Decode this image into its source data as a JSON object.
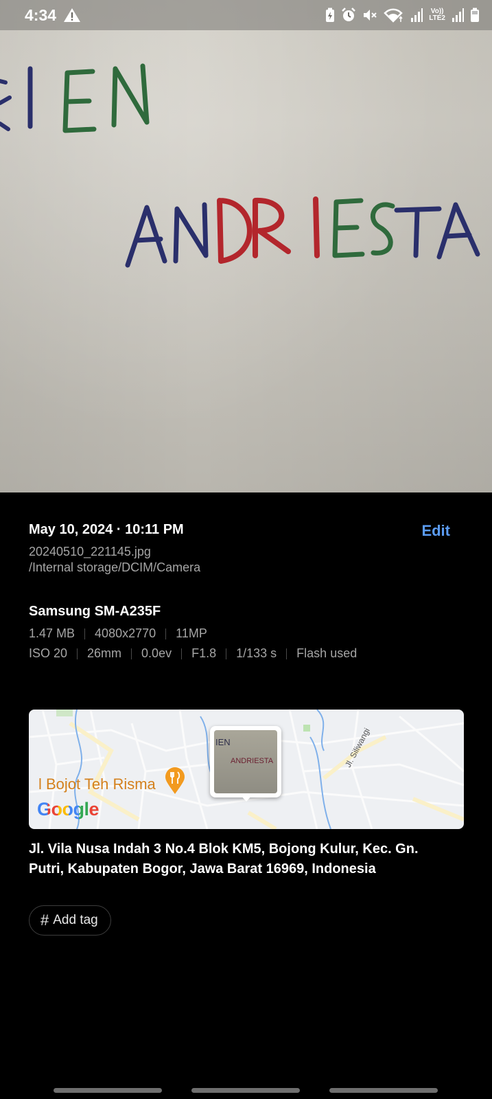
{
  "status_bar": {
    "time": "4:34",
    "icons": [
      "warning-icon",
      "battery-saver-icon",
      "alarm-icon",
      "mute-icon",
      "wifi-icon",
      "signal-icon",
      "volte-icon",
      "signal-icon-2",
      "battery-icon"
    ],
    "volte_label_top": "Vo))",
    "volte_label_bottom": "LTE2"
  },
  "photo": {
    "handwriting_line1": "RIEN",
    "handwriting_line2": "ANDRIESTA"
  },
  "details": {
    "datetime": "May 10, 2024 · 10:11 PM",
    "edit_label": "Edit",
    "filename": "20240510_221145.jpg",
    "path": "/Internal storage/DCIM/Camera",
    "device": "Samsung SM-A235F",
    "specs_row1": [
      "1.47 MB",
      "4080x2770",
      "11MP"
    ],
    "specs_row2": [
      "ISO 20",
      "26mm",
      "0.0ev",
      "F1.8",
      "1/133 s",
      "Flash used"
    ]
  },
  "map": {
    "place_label": "l Bojot Teh Risma",
    "street_label": "Jl. Siliwangi",
    "logo": "Google",
    "thumbnail_line1": "IEN",
    "thumbnail_line2": "ANDRIESTA"
  },
  "address": "Jl. Vila Nusa Indah 3 No.4 Blok KM5, Bojong Kulur, Kec. Gn. Putri, Kabupaten Bogor, Jawa Barat 16969, Indonesia",
  "tag_chip": {
    "label": "Add tag"
  },
  "colors": {
    "accent": "#5b9cf4",
    "background": "#000000",
    "secondary_text": "#a5a5a5"
  }
}
